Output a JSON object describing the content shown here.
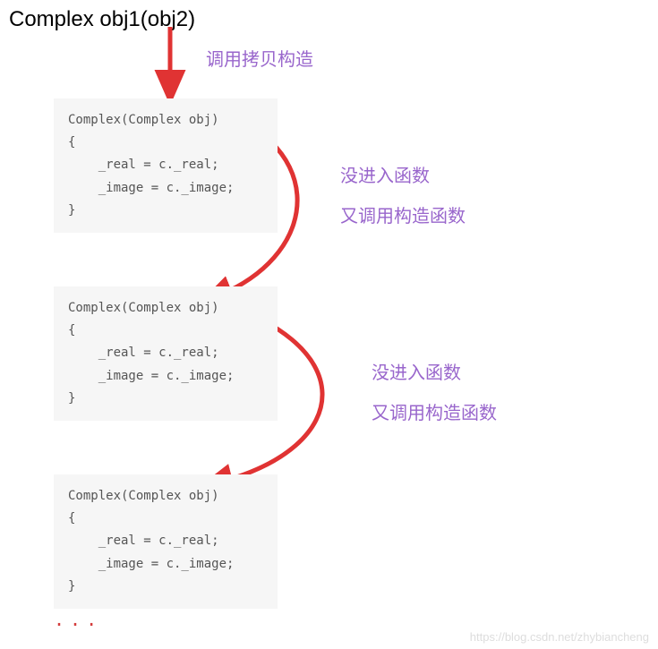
{
  "title": "Complex obj1(obj2)",
  "annotations": {
    "a1": "调用拷贝构造",
    "a2a": "没进入函数",
    "a2b": "又调用构造函数",
    "a3a": "没进入函数",
    "a3b": "又调用构造函数"
  },
  "code": {
    "line1": "Complex(Complex obj)",
    "line2": "{",
    "line3": "    _real = c._real;",
    "line4": "    _image = c._image;",
    "line5": "}"
  },
  "ellipsis": "...",
  "watermark": "https://blog.csdn.net/zhybiancheng"
}
